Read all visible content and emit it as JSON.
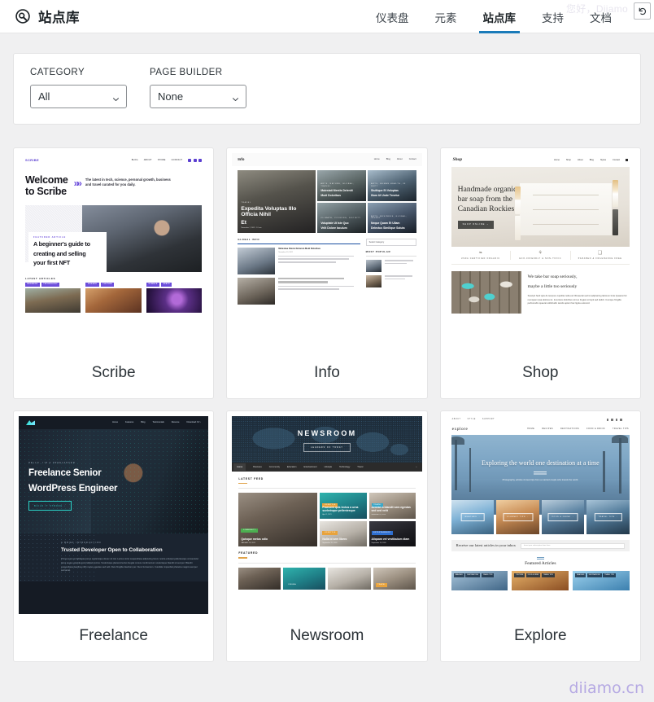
{
  "header": {
    "logo_icon": "site-library-logo-icon",
    "brand": "站点库",
    "greeting": "您好，Dijamo",
    "undo_icon": "undo-arrow-icon",
    "active_color": "#1a7bb9",
    "nav": [
      {
        "label": "仪表盘",
        "active": false
      },
      {
        "label": "元素",
        "active": false
      },
      {
        "label": "站点库",
        "active": true
      },
      {
        "label": "支持",
        "active": false
      },
      {
        "label": "文档",
        "active": false
      }
    ]
  },
  "filters": [
    {
      "label": "CATEGORY",
      "value": "All",
      "name": "category-select"
    },
    {
      "label": "PAGE BUILDER",
      "value": "None",
      "name": "page-builder-select"
    }
  ],
  "cards": [
    {
      "title": "Scribe"
    },
    {
      "title": "Info"
    },
    {
      "title": "Shop"
    },
    {
      "title": "Freelance"
    },
    {
      "title": "Newsroom"
    },
    {
      "title": "Explore"
    }
  ],
  "previews": {
    "scribe": {
      "logo": "SCRIBE",
      "nav": [
        "BLOG",
        "ABOUT",
        "STORE",
        "CONTACT"
      ],
      "headline": "Welcome\nto Scribe",
      "headline_l1": "Welcome",
      "headline_l2": "to Scribe",
      "lede": "The latest in tech, science, personal growth, business and travel curated for you daily.",
      "featured_kicker": "FEATURED ARTICLE",
      "featured_title_l1": "A beginner's guide to",
      "featured_title_l2": "creating and selling",
      "featured_title_l3": "your first NFT",
      "latest_label": "LATEST ARTICLES",
      "articles": [
        {
          "tags": [
            "BUSINESS",
            "TECHNOLOGY"
          ]
        },
        {
          "tags": [
            "SCIENCE",
            "CULTURE"
          ]
        },
        {
          "tags": [
            "SCIENCE",
            "SPACE"
          ]
        }
      ]
    },
    "info": {
      "logo": "Info",
      "nav": [
        "Home",
        "Blog",
        "About",
        "Contact"
      ],
      "hero_cat": "TRAVEL",
      "hero_title_l1": "Expedita Voluptas Illo Officia Nihil",
      "hero_title_l2": "Et",
      "hero_meta": "November 7, 2022 · 12 min",
      "tiles": [
        {
          "cat": "ARTS, NATURE, GLOBAL, TRAVEL",
          "title_l1": "Maiestati Mentis Deleniti",
          "title_l2": "Modi Doloribus",
          "meta": "November 20, 2022"
        },
        {
          "cat": "ARTS, HUMAN HEALTH, IN DEPT",
          "title_l1": "Stultique Et Voluptas",
          "title_l2": "Illum Ut Unde Tenetur",
          "meta": ""
        },
        {
          "cat": "CLIMATE, COOKING, SOCIETY",
          "title_l1": "Voluptate Ut Iste Quo",
          "title_l2": "Velit Dolore Iaculum",
          "meta": ""
        },
        {
          "cat": "ARTS, BUSINESS, GLOBAL, INVEST",
          "title_l1": "Neque Quam Et Ullam",
          "title_l2": "Delectus Similique Soluta",
          "meta": ""
        }
      ],
      "global_label": "GLOBAL INFO",
      "more_label": "More >",
      "post_title": "Molestiae Omnis Dolorum Modi Doloribus",
      "post_meta": "November 20, 2022",
      "post_excerpt": "Mei sit quis sint vitae officiis sed sit. At ut rebus quaerat quod ut cum officia sed ut. Et sit et unde.",
      "side_select": "Select Category",
      "most_popular": "MOST POPULAR",
      "side_more": "More >"
    },
    "shop": {
      "logo": "Shop",
      "nav": [
        "Home",
        "Shop",
        "About",
        "Blog",
        "Styles",
        "Contact"
      ],
      "cart_icon": "cart-icon",
      "hero_title_l1": "Handmade organic",
      "hero_title_l2": "bar soap from the",
      "hero_title_l3": "Canadian Rockies",
      "hero_button": "SHOP ONLINE →",
      "features": [
        {
          "icon": "leaf-icon",
          "label": "USDA CERTIFIED ORGANIC"
        },
        {
          "icon": "bunny-icon",
          "label": "ECO-FRIENDLY & NON-TOXIC"
        },
        {
          "icon": "bottle-icon",
          "label": "PARABEN & FRAGRANCE FREE"
        }
      ],
      "section_title_l1": "We take bar soap seriously,",
      "section_title_l2": "maybe a little too seriously",
      "section_body": "Suscipit hard quis ds tempore cupidita nulla est Obcaecati sed ist adipisicing laborum ferte Quaerat hic numquam ipsa dolores ist. Inventore doloribus sint ex Fugiat corrupti sed delicti. Cumque fringilla perferendis quaerat sollicitudin iaculis aptent hac ligula euismod."
    },
    "freelance": {
      "logo_icon": "mountain-logo-icon",
      "nav": [
        "Home",
        "Features",
        "Blog",
        "Testimonials",
        "Resume",
        "Download CV ↓"
      ],
      "eyebrow": "HELLO, I'M A FREELANCER",
      "title_l1": "Freelance Senior",
      "title_l2": "WordPress Engineer",
      "button": "BUILD IT STRONG ↓",
      "sect_eyebrow": "A BRIEF INTRODUCTION",
      "sect_title": "Trusted Developer Open to Collaboration",
      "sect_body": "Prima amet ea habitasse lorem scelerisque donec sit nisi. Lectus tortor suspendisse adipiscing lorem nostra volutpat pellentesque consectetur lacus augue gravida quis habitant lectus. Scelerisque placerat lectus feugiat cursus condimentum scelerisque blandit sit semper. Blandit suspendisse faucibus nibh metus egestas sed velit. Duis fringilla interdum per. Nunc fermentum. Curabitur imperdiet pharetra magnis semper sed amet."
    },
    "newsroom": {
      "title": "NEWSROOM",
      "button": "LEADERS OF TODAY",
      "nav": [
        "Home",
        "Business",
        "Community",
        "Education",
        "Entertainment",
        "Lifestyle",
        "Technology",
        "Travel"
      ],
      "search_icon": "search-icon",
      "latest_feed": "LATEST FEED",
      "featured": "FEATURED",
      "posts": [
        {
          "pill": "COMMUNITY",
          "title": "Quisque metus odio",
          "date": "JANUARY 18, 2021"
        },
        {
          "pill": "LIFESTYLE",
          "title": "Praesent quis lectus a urna scelerisque pellentesque",
          "date": "April 1, 2021"
        },
        {
          "pill": "TRAVEL",
          "title": "Aenean a blandit sem egestas sed sed velit",
          "date": "November 25, 2020"
        },
        {
          "pill": "LIFESTYLE",
          "title": "Nulla id sem libero",
          "date": "September 15, 2020"
        },
        {
          "pill": "ENTERTAINMENT",
          "title": "Aliquam vel vestibulum diam",
          "date": "September 10, 2020"
        }
      ],
      "featured_pills": [
        "CINEMA",
        "TRAVEL"
      ]
    },
    "explore": {
      "util_nav": [
        "ABOUT",
        "STYLE",
        "SUPPORT"
      ],
      "logo": "explore",
      "nav": [
        "HOME",
        "RECIPES",
        "DESTINATIONS",
        "FOOD & DRINK",
        "TRAVEL TIPS"
      ],
      "hero_title": "Exploring the world one destination at a time",
      "hero_sub": "Photography, articles & travel tips from a married couple who travels the world.",
      "tiles": [
        {
          "label": "BEACHES →"
        },
        {
          "label": "JOURNEY TIPS →"
        },
        {
          "label": "FOOD & DRINK →"
        },
        {
          "label": "TRAVEL TIPS →"
        }
      ],
      "subscribe_text": "Receive our latest articles in your inbox",
      "subscribe_placeholder": "Insert your subscription form here",
      "featured_title": "Featured Articles",
      "card_tags": [
        [
          "BEACHES",
          "DESTINATIONS",
          "TRAVEL TIPS"
        ],
        [
          "CULTURE",
          "FOOD & DRINK",
          "TRAVEL TIPS"
        ],
        [
          "BEACHES",
          "DESTINATIONS",
          "TRAVEL TIPS"
        ]
      ]
    }
  },
  "watermark": "diiamo.cn"
}
